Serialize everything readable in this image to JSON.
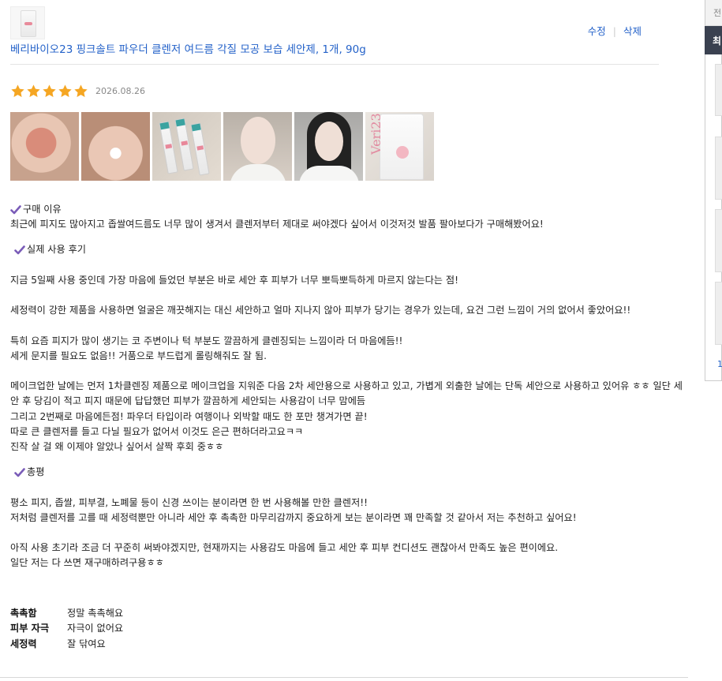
{
  "product": {
    "title": "베리바이오23 핑크솔트 파우더 클렌저 여드름 각질 모공 보습 세안제, 1개, 90g",
    "thumbnail_icon": "product-pouch-icon"
  },
  "actions": {
    "edit_label": "수정",
    "delete_label": "삭제"
  },
  "rating": {
    "stars": 5,
    "max": 5,
    "date": "2026.08.26",
    "star_color": "#f5a623"
  },
  "photos": [
    {
      "name": "review-photo-1"
    },
    {
      "name": "review-photo-2"
    },
    {
      "name": "review-photo-3"
    },
    {
      "name": "review-photo-4"
    },
    {
      "name": "review-photo-5"
    },
    {
      "name": "review-photo-6",
      "brand_text": "Veri23"
    }
  ],
  "review": {
    "section1_title": "구매 이유",
    "section1_body": "최근에 피지도 많아지고 좁쌀여드름도 너무 많이 생겨서 클렌저부터 제대로 써야겠다 싶어서 이것저것 발품 팔아보다가 구매해봤어요!",
    "section2_title": "실제 사용 후기",
    "section2_p1": "지금 5일째 사용 중인데 가장 마음에 들었던 부분은 바로 세안 후 피부가 너무 뽀득뽀득하게 마르지 않는다는 점!",
    "section2_p2": "세정력이 강한 제품을 사용하면 얼굴은 깨끗해지는 대신 세안하고 얼마 지나지 않아 피부가 당기는 경우가 있는데, 요건 그런 느낌이 거의 없어서 좋았어요!!",
    "section2_p3_l1": "특히 요즘 피지가 많이 생기는 코 주변이나 턱 부분도 깔끔하게 클렌징되는 느낌이라 더 마음에듬!!",
    "section2_p3_l2": "세게 문지를 필요도 없음!! 거품으로 부드럽게 롤링해줘도 잘 됨.",
    "section2_p4_l1": "메이크업한 날에는 먼저 1차클렌징 제품으로 메이크업을 지워준 다음 2차 세안용으로 사용하고 있고, 가볍게 외출한 날에는 단독 세안으로 사용하고 있어유 ㅎㅎ 일단 세안 후 당김이 적고 피지 때문에 답답했던 피부가 깔끔하게 세안되는 사용감이 너무 맘에듬",
    "section2_p4_l2": "그리고 2번째로 마음에든점! 파우더 타입이라 여행이나 외박할 때도 한 포만 챙겨가면 끝!",
    "section2_p4_l3": "따로 큰 클렌저를 들고 다닐 필요가 없어서 이것도 은근 편하더라고요ㅋㅋ",
    "section2_p4_l4": "진작 살 걸 왜 이제야 알았나 싶어서 살짝 후회 중ㅎㅎ",
    "section3_title": "총평",
    "section3_p1_l1": "평소 피지, 좁쌀, 피부결, 노폐물 등이 신경 쓰이는 분이라면 한 번 사용해볼 만한 클렌저!!",
    "section3_p1_l2": "저처럼 클렌저를 고를 때 세정력뿐만 아니라 세안 후 촉촉한 마무리감까지 중요하게 보는 분이라면 꽤 만족할 것 같아서 저는 추천하고 싶어요!",
    "section3_p2_l1": "아직 사용 초기라 조금 더 꾸준히 써봐야겠지만, 현재까지는 사용감도 마음에 들고 세안 후 피부 컨디션도 괜찮아서 만족도 높은 편이에요.",
    "section3_p2_l2": "일단 저는 다 쓰면 재구매하려구용ㅎㅎ",
    "check_color": "#7a5cb8"
  },
  "survey": [
    {
      "label": "촉촉함",
      "value": "정말 촉촉해요"
    },
    {
      "label": "피부 자극",
      "value": "자극이 없어요"
    },
    {
      "label": "세정력",
      "value": "잘 닦여요"
    }
  ],
  "side_panel": {
    "tab_char": "전",
    "band_char": "최",
    "number": "1"
  },
  "colors": {
    "link": "#2462c9",
    "date": "#888888"
  }
}
